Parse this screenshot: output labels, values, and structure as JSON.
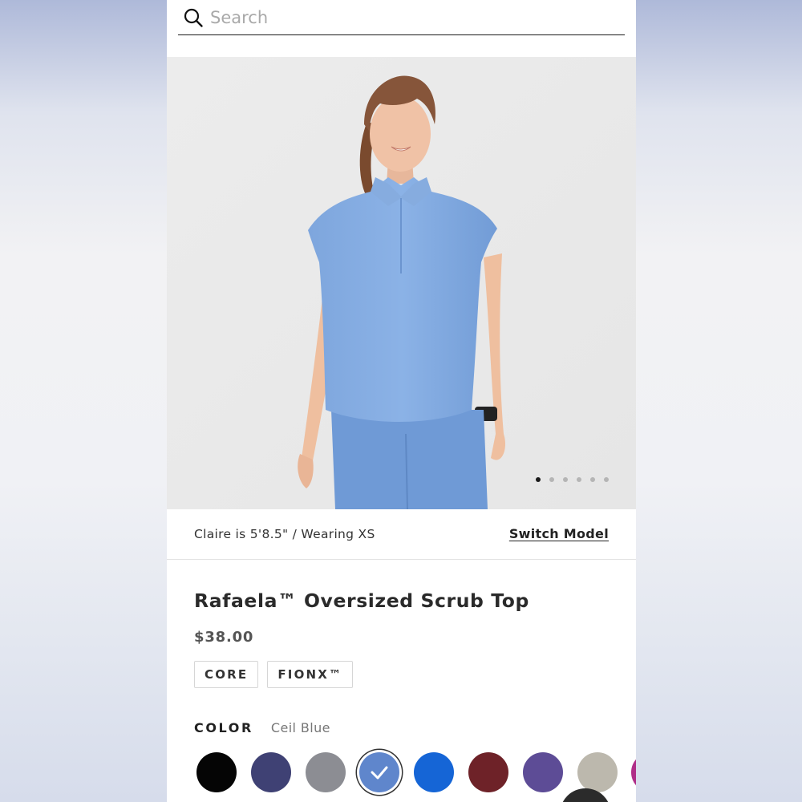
{
  "search": {
    "placeholder": "Search",
    "value": ""
  },
  "gallery": {
    "total_images": 6,
    "active_index": 0
  },
  "model": {
    "info": "Claire is 5'8.5\" / Wearing XS",
    "switch_label": "Switch Model"
  },
  "product": {
    "title": "Rafaela™ Oversized Scrub Top",
    "price": "$38.00",
    "tags": [
      "CORE",
      "FIONX™"
    ]
  },
  "color": {
    "label": "COLOR",
    "selected_name": "Ceil Blue",
    "swatches": [
      {
        "hex": "#050505",
        "selected": false
      },
      {
        "hex": "#3f4174",
        "selected": false
      },
      {
        "hex": "#8c8d93",
        "selected": false
      },
      {
        "hex": "#5f86cc",
        "selected": true
      },
      {
        "hex": "#1565d6",
        "selected": false
      },
      {
        "hex": "#6e2228",
        "selected": false
      },
      {
        "hex": "#5d4c96",
        "selected": false
      },
      {
        "hex": "#bcb8ad",
        "selected": false
      },
      {
        "hex": "#b02e88",
        "selected": false
      }
    ]
  },
  "icons": {
    "search": "search-icon",
    "check": "checkmark-icon"
  }
}
